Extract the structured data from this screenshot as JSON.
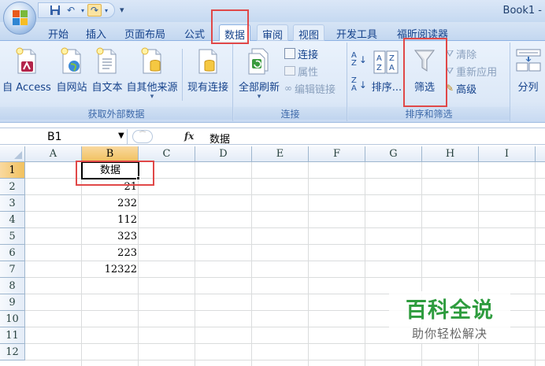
{
  "window": {
    "title": "Book1 -"
  },
  "tabs": [
    {
      "label": "开始"
    },
    {
      "label": "插入"
    },
    {
      "label": "页面布局"
    },
    {
      "label": "公式"
    },
    {
      "label": "数据"
    },
    {
      "label": "审阅"
    },
    {
      "label": "视图"
    },
    {
      "label": "开发工具"
    },
    {
      "label": "福昕阅读器"
    }
  ],
  "ribbon": {
    "external": {
      "access": "自 Access",
      "web": "自网站",
      "text": "自文本",
      "other": "自其他来源",
      "existing": "现有连接",
      "group_label": "获取外部数据"
    },
    "connections": {
      "refresh_all": "全部刷新",
      "connections": "连接",
      "properties": "属性",
      "edit_links": "编辑链接",
      "group_label": "连接"
    },
    "sort_filter": {
      "sort": "排序...",
      "filter": "筛选",
      "clear": "清除",
      "reapply": "重新应用",
      "advanced": "高级",
      "group_label": "排序和筛选"
    },
    "tools": {
      "split": "分列"
    }
  },
  "formula_bar": {
    "name_box": "B1",
    "fx": "fx",
    "content": "数据"
  },
  "sheet": {
    "columns": [
      "A",
      "B",
      "C",
      "D",
      "E",
      "F",
      "G",
      "H",
      "I"
    ],
    "rows": [
      "1",
      "2",
      "3",
      "4",
      "5",
      "6",
      "7",
      "8",
      "9",
      "10",
      "11",
      "12"
    ],
    "cells": [
      {
        "ref": "B1",
        "value": "数据"
      },
      {
        "ref": "B2",
        "value": "21"
      },
      {
        "ref": "B3",
        "value": "232"
      },
      {
        "ref": "B4",
        "value": "112"
      },
      {
        "ref": "B5",
        "value": "323"
      },
      {
        "ref": "B6",
        "value": "223"
      },
      {
        "ref": "B7",
        "value": "12322"
      }
    ],
    "selected_cell": "B1"
  },
  "watermark": {
    "title": "百科全说",
    "subtitle": "助你轻松解决"
  },
  "colors": {
    "highlight": "#e04848",
    "selected_header": "#f1c15f",
    "watermark_green": "#2e9c3e"
  }
}
